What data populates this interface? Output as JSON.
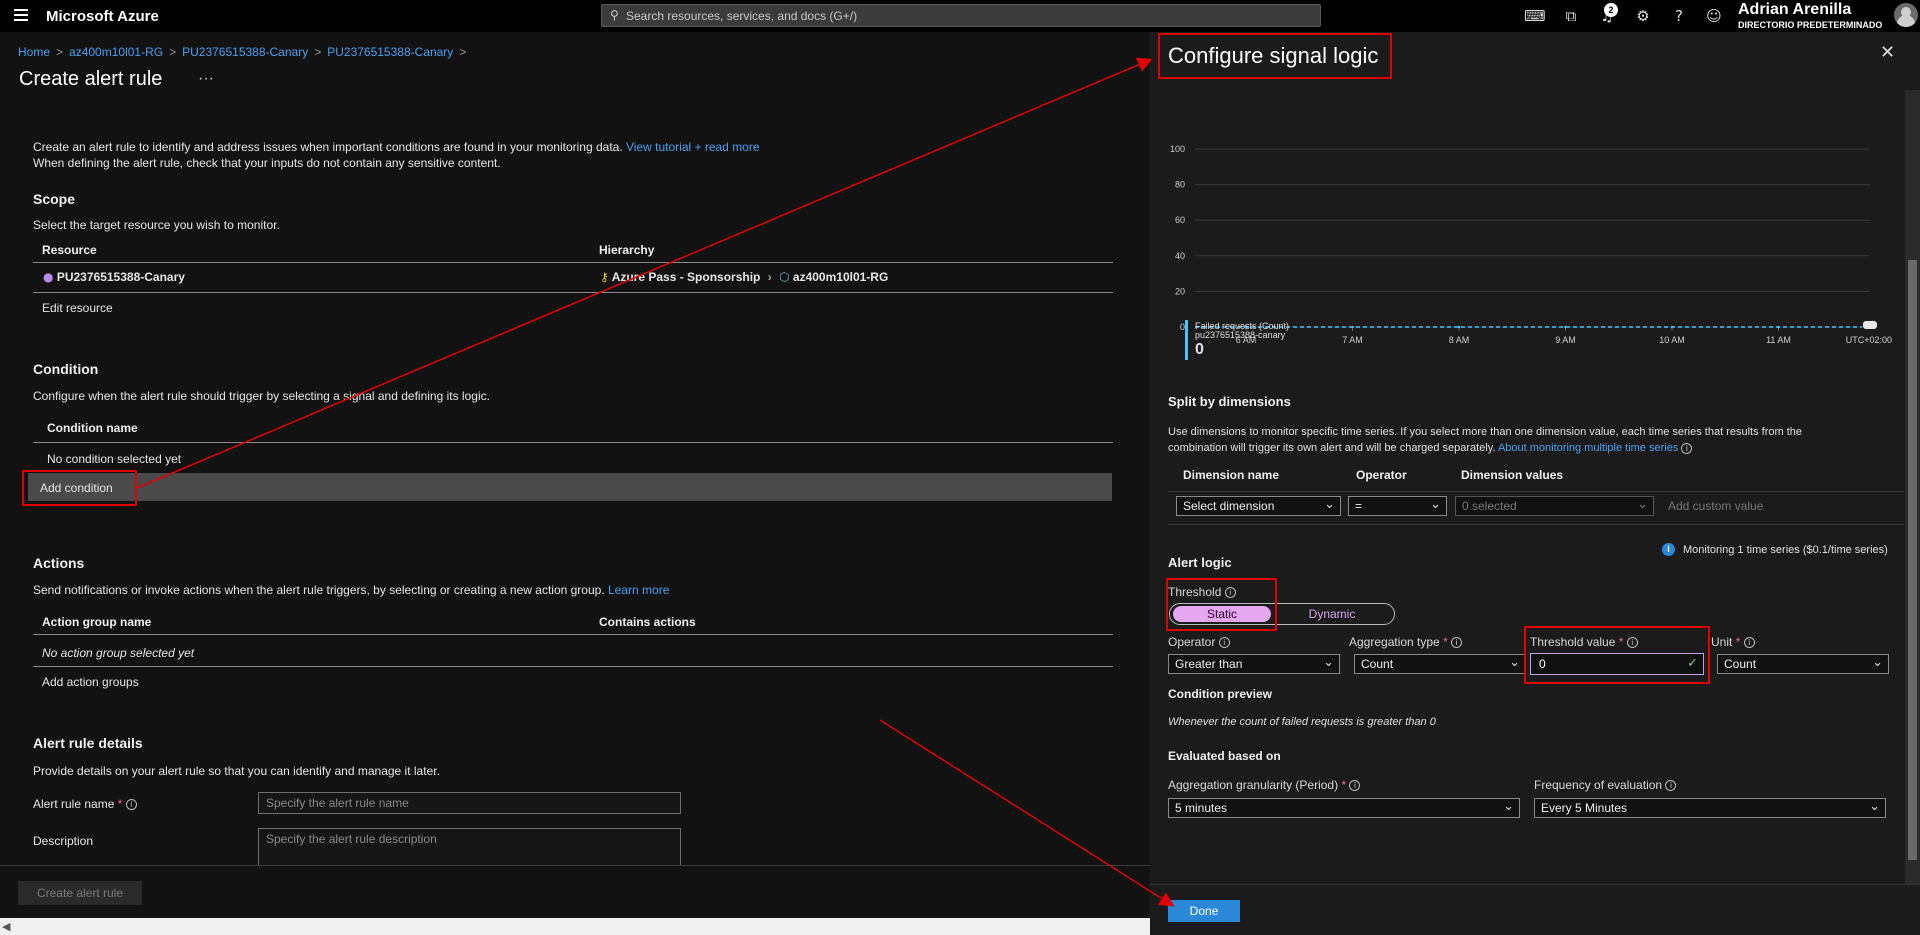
{
  "topbar": {
    "brand": "Microsoft Azure",
    "search_placeholder": "Search resources, services, and docs (G+/)",
    "notifications_count": "2",
    "user_name": "Adrian Arenilla",
    "user_directory": "DIRECTORIO PREDETERMINADO",
    "icons": [
      "cloud-shell-icon",
      "portal-settings-icon",
      "bell-icon",
      "gear-icon",
      "help-icon",
      "feedback-icon"
    ]
  },
  "breadcrumb": [
    "Home",
    "az400m10l01-RG",
    "PU2376515388-Canary",
    "PU2376515388-Canary"
  ],
  "page_title": "Create alert rule",
  "page_menu": "···",
  "intro": {
    "line1": "Create an alert rule to identify and address issues when important conditions are found in your monitoring data.",
    "tutorial_link": "View tutorial + read more",
    "line2": "When defining the alert rule, check that your inputs do not contain any sensitive content."
  },
  "scope": {
    "heading": "Scope",
    "desc": "Select the target resource you wish to monitor.",
    "col_resource": "Resource",
    "col_hierarchy": "Hierarchy",
    "resource_name": "PU2376515388-Canary",
    "hierarchy_subscription": "Azure Pass - Sponsorship",
    "hierarchy_rg": "az400m10l01-RG",
    "edit_link": "Edit resource"
  },
  "condition": {
    "heading": "Condition",
    "desc": "Configure when the alert rule should trigger by selecting a signal and defining its logic.",
    "col_name": "Condition name",
    "empty": "No condition selected yet",
    "add_link": "Add condition"
  },
  "actions": {
    "heading": "Actions",
    "desc": "Send notifications or invoke actions when the alert rule triggers, by selecting or creating a new action group.",
    "learn_more": "Learn more",
    "col_group": "Action group name",
    "col_contains": "Contains actions",
    "empty": "No action group selected yet",
    "add_link": "Add action groups"
  },
  "details": {
    "heading": "Alert rule details",
    "desc": "Provide details on your alert rule so that you can identify and manage it later.",
    "name_label": "Alert rule name",
    "name_placeholder": "Specify the alert rule name",
    "desc_label": "Description",
    "desc_placeholder": "Specify the alert rule description"
  },
  "create_button": "Create alert rule",
  "panel": {
    "title": "Configure signal logic",
    "close": "✕",
    "done_button": "Done",
    "chart_legend_line1": "Failed requests (Count)",
    "chart_legend_line2": "pu2376515388-canary",
    "chart_legend_value": "0",
    "split": {
      "heading": "Split by dimensions",
      "desc1": "Use dimensions to monitor specific time series. If you select more than one dimension value, each time series that results from the",
      "desc2": "combination will trigger its own alert and will be charged separately.",
      "link": "About monitoring multiple time series",
      "col_name": "Dimension name",
      "col_operator": "Operator",
      "col_values": "Dimension values",
      "select_dimension": "Select dimension",
      "operator_value": "=",
      "values_value": "0 selected",
      "custom_value": "Add custom value"
    },
    "monitoring_note": "Monitoring 1 time series ($0.1/time series)",
    "alert_logic": {
      "heading": "Alert logic",
      "threshold_label": "Threshold",
      "static": "Static",
      "dynamic": "Dynamic",
      "operator_label": "Operator",
      "operator_value": "Greater than",
      "aggregation_label": "Aggregation type",
      "aggregation_value": "Count",
      "threshold_value_label": "Threshold value",
      "threshold_value": "0",
      "unit_label": "Unit",
      "unit_value": "Count"
    },
    "preview": {
      "heading": "Condition preview",
      "text": "Whenever the count of failed requests is greater than 0"
    },
    "evaluated": {
      "heading": "Evaluated based on",
      "granularity_label": "Aggregation granularity (Period)",
      "granularity_value": "5 minutes",
      "frequency_label": "Frequency of evaluation",
      "frequency_value": "Every 5 Minutes"
    }
  },
  "chart_data": {
    "type": "line",
    "x": [
      "6 AM",
      "7 AM",
      "8 AM",
      "9 AM",
      "10 AM",
      "11 AM"
    ],
    "timezone_label": "UTC+02:00",
    "y_ticks": [
      0,
      20,
      40,
      60,
      80,
      100
    ],
    "ylim": [
      0,
      100
    ],
    "series": [
      {
        "name": "Failed requests (Count)",
        "values": [
          0,
          0,
          0,
          0,
          0,
          0
        ]
      }
    ],
    "colors": {
      "series": "#4cc2ff"
    }
  }
}
